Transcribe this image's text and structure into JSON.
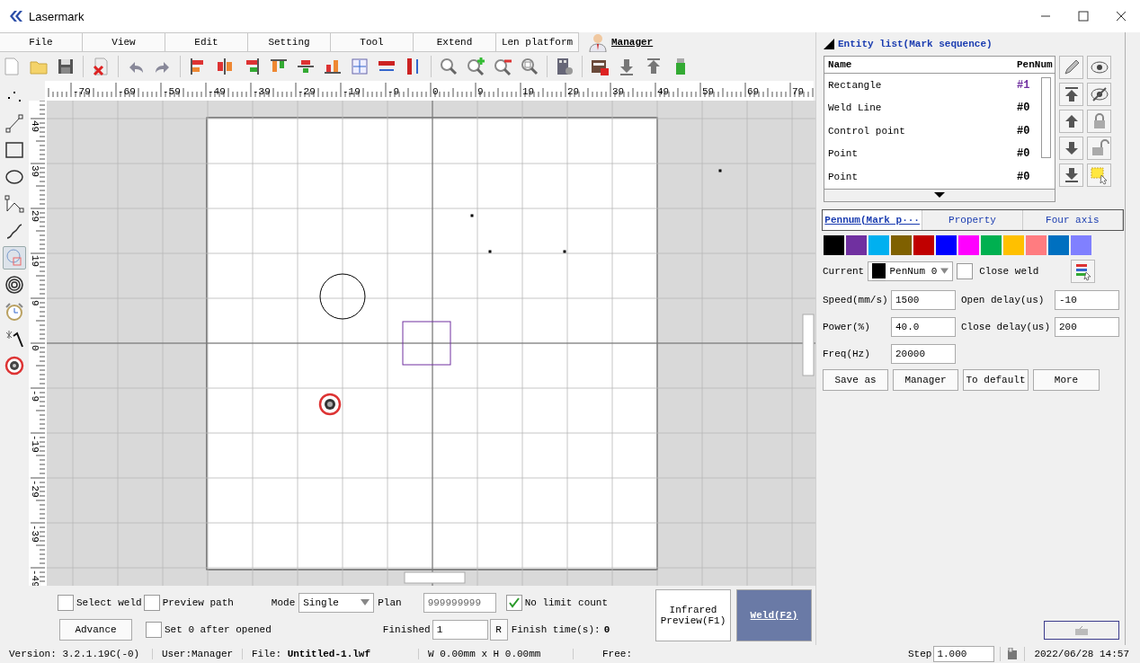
{
  "window": {
    "title": "Lasermark"
  },
  "menu": [
    {
      "label": "File"
    },
    {
      "label": "View"
    },
    {
      "label": "Edit"
    },
    {
      "label": "Setting"
    },
    {
      "label": "Tool"
    },
    {
      "label": "Extend"
    },
    {
      "label": "Len platform"
    }
  ],
  "user": {
    "name": "Manager"
  },
  "left_tools": [
    {
      "kind": "points",
      "selected": false
    },
    {
      "kind": "line",
      "selected": false
    },
    {
      "kind": "rect",
      "selected": false
    },
    {
      "kind": "ellipse",
      "selected": false
    },
    {
      "kind": "polyline",
      "selected": false
    },
    {
      "kind": "curve",
      "selected": false
    },
    {
      "kind": "combine",
      "selected": true
    },
    {
      "kind": "spiral",
      "selected": false
    },
    {
      "kind": "timer",
      "selected": false
    },
    {
      "kind": "wand",
      "selected": false
    },
    {
      "kind": "target",
      "selected": false
    }
  ],
  "ruler": {
    "x_labels": [
      "-79",
      "-69",
      "-59",
      "-49",
      "-39",
      "-29",
      "-19",
      "-9",
      "0",
      "9",
      "19",
      "29",
      "39",
      "49",
      "59",
      "69",
      "79"
    ],
    "y_labels": [
      "49",
      "39",
      "29",
      "19",
      "9",
      "0",
      "-9",
      "-19",
      "-29",
      "-39",
      "-49"
    ]
  },
  "entity_list": {
    "title": "Entity list(Mark sequence)",
    "columns": [
      "Name",
      "PenNum"
    ],
    "rows": [
      {
        "name": "Rectangle",
        "pen": "#1",
        "color": "#7030a0"
      },
      {
        "name": "Weld Line",
        "pen": "#0",
        "color": "#000000"
      },
      {
        "name": "Control point",
        "pen": "#0",
        "color": "#000000"
      },
      {
        "name": "Point",
        "pen": "#0",
        "color": "#000000"
      },
      {
        "name": "Point",
        "pen": "#0",
        "color": "#000000"
      }
    ]
  },
  "pen_tabs": [
    {
      "label": "Pennum(Mark p···",
      "selected": true
    },
    {
      "label": "Property",
      "selected": false
    },
    {
      "label": "Four axis",
      "selected": false
    }
  ],
  "pen_colors": [
    {
      "color": "#000000"
    },
    {
      "color": "#7030a0"
    },
    {
      "color": "#00b0f0"
    },
    {
      "color": "#7f6000"
    },
    {
      "color": "#c00000"
    },
    {
      "color": "#0000ff"
    },
    {
      "color": "#ff00ff"
    },
    {
      "color": "#00b050"
    },
    {
      "color": "#ffc000"
    },
    {
      "color": "#ff7c80"
    },
    {
      "color": "#0070c0"
    },
    {
      "color": "#8080ff"
    }
  ],
  "current": {
    "label": "Current",
    "color": "#000000",
    "value": "PenNum 0"
  },
  "close_weld": {
    "label": "Close weld",
    "checked": false
  },
  "params": [
    {
      "label": "Speed(mm/s)",
      "value": "1500"
    },
    {
      "label": "Open delay(us)",
      "value": "-10"
    },
    {
      "label": "Power(%)",
      "value": "40.0"
    },
    {
      "label": "Close delay(us)",
      "value": "200"
    },
    {
      "label": "Freq(Hz)",
      "value": "20000"
    }
  ],
  "pen_buttons": [
    "Save as",
    "Manager",
    "To default",
    "More"
  ],
  "controls": {
    "select_weld": {
      "label": "Select weld",
      "checked": false
    },
    "preview_path": {
      "label": "Preview path",
      "checked": false
    },
    "mode": {
      "label": "Mode",
      "value": "Single"
    },
    "plan": {
      "label": "Plan",
      "value": "999999999",
      "disabled": true
    },
    "no_limit": {
      "label": "No limit count",
      "checked": true
    },
    "advance": "Advance",
    "set_zero": {
      "label": "Set 0 after opened",
      "checked": false
    },
    "finished": {
      "label": "Finished",
      "value": "1"
    },
    "reset": "R",
    "finish_time": {
      "label": "Finish time(s):",
      "value": "0"
    },
    "infrared": "Infrared Preview(F1)",
    "weld": "Weld(F2)"
  },
  "status_bar": {
    "version": "Version: 3.2.1.19C(-0)",
    "user": "User:Manager",
    "file_label": "File:",
    "file": "Untitled-1.lwf",
    "size": "W 0.00mm x H 0.00mm",
    "free": "Free:",
    "step_label": "Step",
    "step": "1.000",
    "datetime": "2022/06/28 14:57"
  }
}
